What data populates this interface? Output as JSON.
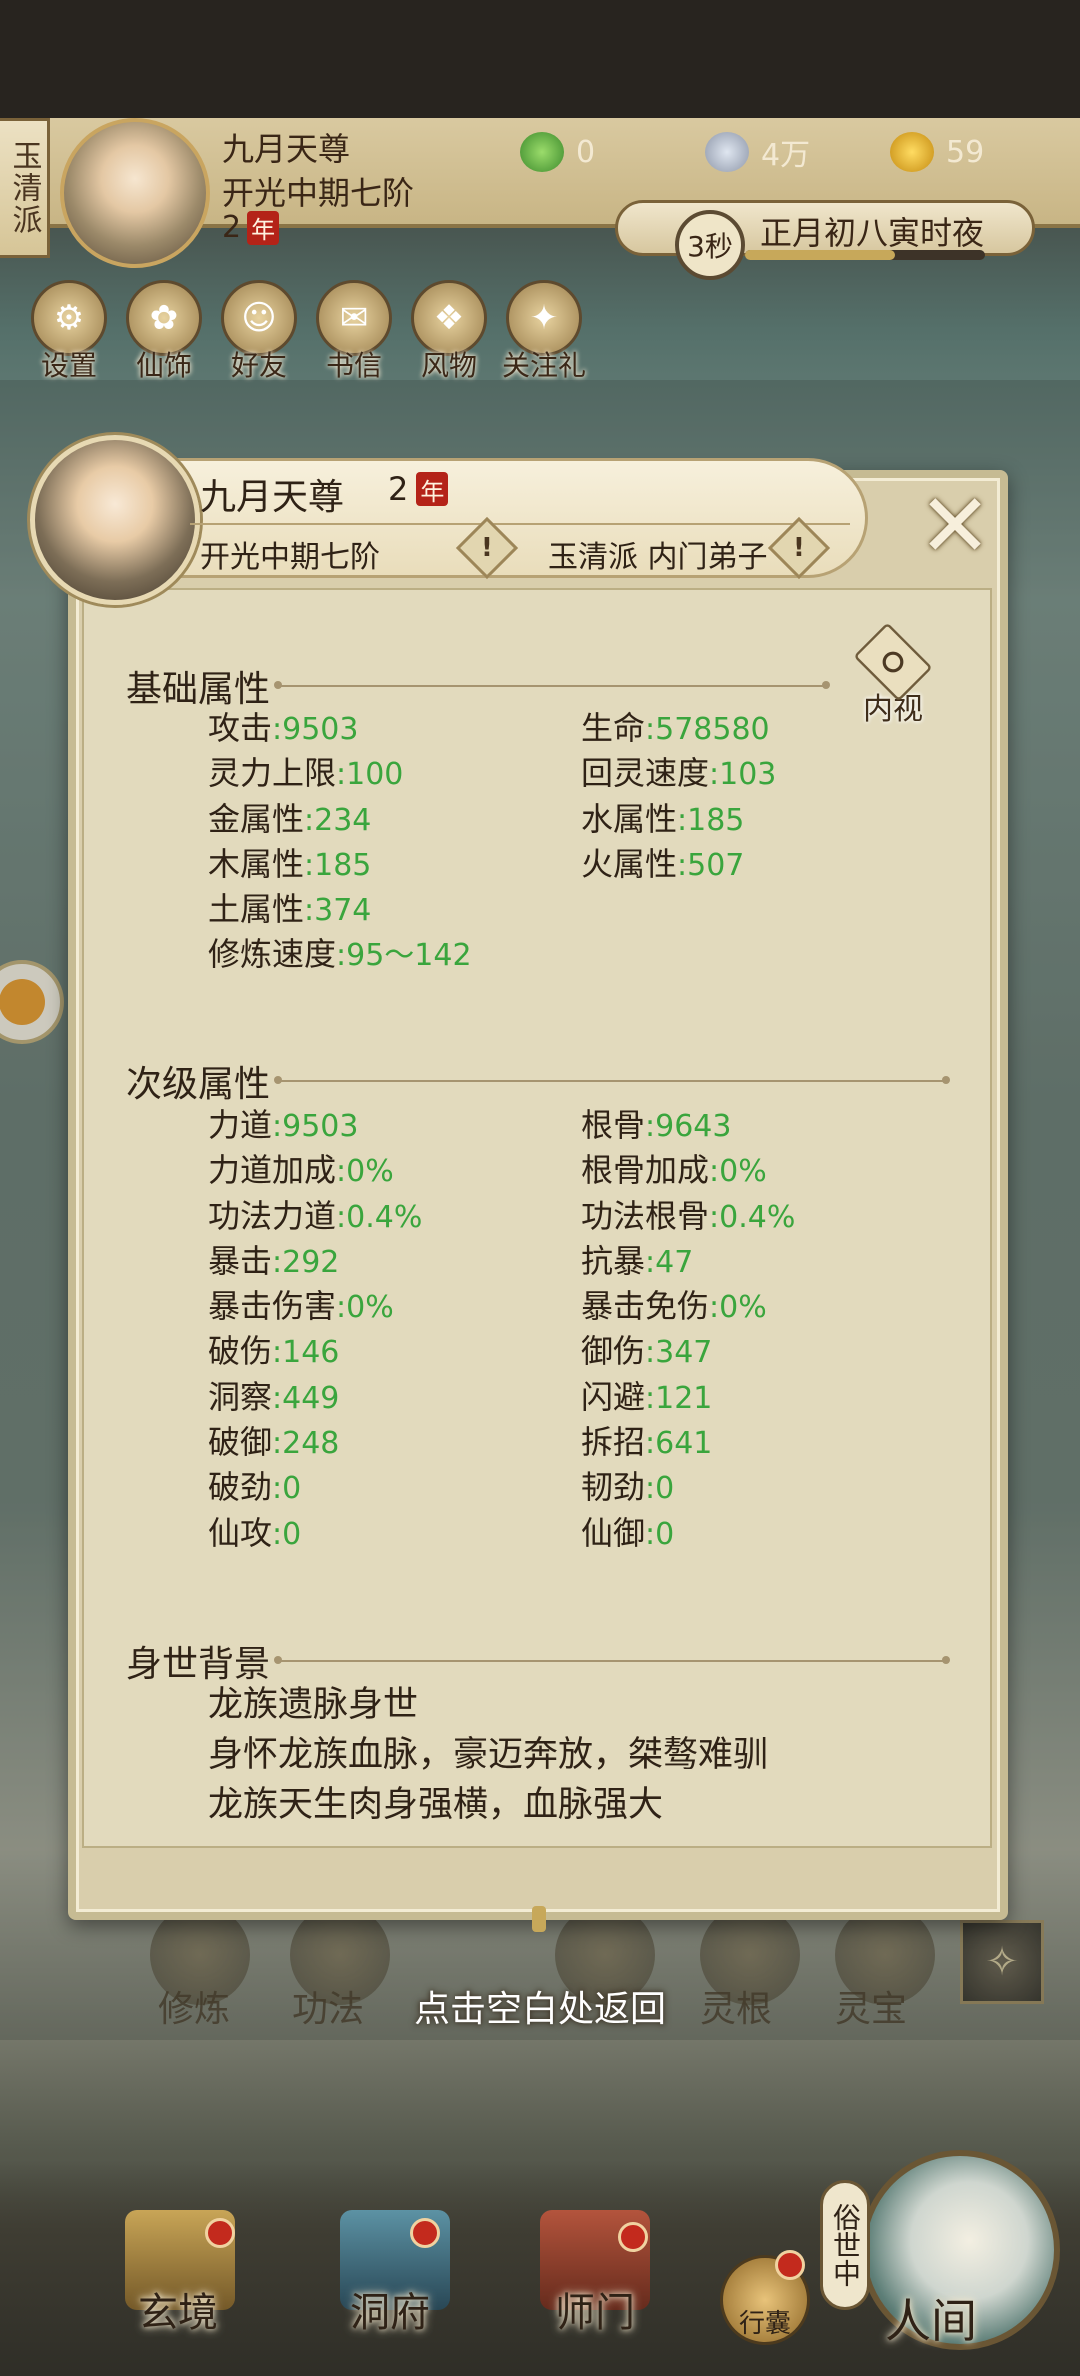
{
  "top_bar": {
    "sect_tag": "玉清派",
    "player_name": "九月天尊",
    "player_rank": "开光中期七阶",
    "player_age": "2",
    "age_unit": "年",
    "resources": [
      {
        "icon": "jade-icon",
        "value": "0"
      },
      {
        "icon": "copper-coin-icon",
        "value": "4万"
      },
      {
        "icon": "gold-ingot-icon",
        "value": "59"
      }
    ],
    "time_seconds": "3秒",
    "time_label": "正月初八寅时夜"
  },
  "quick_menu": [
    {
      "label": "设置",
      "icon": "settings-icon"
    },
    {
      "label": "仙饰",
      "icon": "outfit-icon"
    },
    {
      "label": "好友",
      "icon": "friends-icon"
    },
    {
      "label": "书信",
      "icon": "letter-icon"
    },
    {
      "label": "风物",
      "icon": "scenery-icon"
    },
    {
      "label": "关注礼",
      "icon": "follow-gift-icon"
    }
  ],
  "modal": {
    "name": "九月天尊",
    "age": "2",
    "age_unit": "年",
    "rank": "开光中期七阶",
    "sect": "玉清派 内门弟子",
    "inner_view_label": "内视",
    "basic_title": "基础属性",
    "basic_attrs": [
      {
        "label": "攻击",
        "value": ":9503"
      },
      {
        "label": "生命",
        "value": ":578580"
      },
      {
        "label": "灵力上限",
        "value": ":100"
      },
      {
        "label": "回灵速度",
        "value": ":103"
      },
      {
        "label": "金属性",
        "value": ":234"
      },
      {
        "label": "水属性",
        "value": ":185"
      },
      {
        "label": "木属性",
        "value": ":185"
      },
      {
        "label": "火属性",
        "value": ":507"
      },
      {
        "label": "土属性",
        "value": ":374"
      },
      {
        "label": "",
        "value": ""
      },
      {
        "label": "修炼速度",
        "value": ":95～142"
      }
    ],
    "second_title": "次级属性",
    "second_attrs": [
      {
        "label": "力道",
        "value": ":9503"
      },
      {
        "label": "根骨",
        "value": ":9643"
      },
      {
        "label": "力道加成",
        "value": ":0%"
      },
      {
        "label": "根骨加成",
        "value": ":0%"
      },
      {
        "label": "功法力道",
        "value": ":0.4%"
      },
      {
        "label": "功法根骨",
        "value": ":0.4%"
      },
      {
        "label": "暴击",
        "value": ":292"
      },
      {
        "label": "抗暴",
        "value": ":47"
      },
      {
        "label": "暴击伤害",
        "value": ":0%"
      },
      {
        "label": "暴击免伤",
        "value": ":0%"
      },
      {
        "label": "破伤",
        "value": ":146"
      },
      {
        "label": "御伤",
        "value": ":347"
      },
      {
        "label": "洞察",
        "value": ":449"
      },
      {
        "label": "闪避",
        "value": ":121"
      },
      {
        "label": "破御",
        "value": ":248"
      },
      {
        "label": "拆招",
        "value": ":641"
      },
      {
        "label": "破劲",
        "value": ":0"
      },
      {
        "label": "韧劲",
        "value": ":0"
      },
      {
        "label": "仙攻",
        "value": ":0"
      },
      {
        "label": "仙御",
        "value": ":0"
      }
    ],
    "background_title": "身世背景",
    "background_lines": [
      "龙族遗脉身世",
      "身怀龙族血脉，豪迈奔放，桀骜难驯",
      "龙族天生肉身强横，血脉强大"
    ],
    "close_hint": "点击空白处返回"
  },
  "behind_menu": [
    "修炼",
    "功法",
    "灵根",
    "灵宝"
  ],
  "bottom_nav": {
    "items": [
      "玄境",
      "洞府",
      "师门"
    ],
    "bag_label": "行囊",
    "world_tag": "俗世中",
    "world_label": "人间"
  },
  "colors": {
    "value_green": "#3aa53d",
    "age_badge_red": "#b42318"
  }
}
